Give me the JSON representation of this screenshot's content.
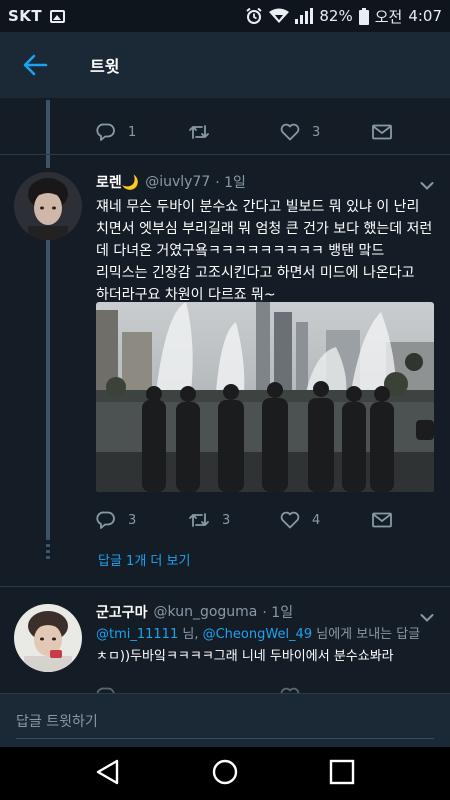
{
  "status_bar": {
    "carrier": "SKT",
    "battery": "82%",
    "time_prefix": "오전",
    "time": "4:07"
  },
  "header": {
    "title": "트윗"
  },
  "prev_tweet": {
    "partial_text": "· ···   ··· ·· ···",
    "replies": "1",
    "retweets": "",
    "likes": "3"
  },
  "tweet": {
    "name": "로렌🌙",
    "handle": "@iuvly77",
    "time": "· 1일",
    "lines": [
      "쟤네 무슨 두바이 분수쇼 간다고 빌보드 뭐 있냐 이 난리",
      "치면서 엣부심 부리길래 뭐 엄청 큰 건가 보다 했는데 저런",
      "데 다녀온 거였구욬ㅋㅋㅋㅋㅋㅋㅋㅋㅋ 뱅탠 맠드",
      "리믹스는 긴장감 고조시킨다고 하면서 미드에 나온다고",
      "하더라구요 차원이 다르죠 뭐~"
    ],
    "replies": "3",
    "retweets": "3",
    "likes": "4",
    "more_replies": "답글 1개 더 보기"
  },
  "reply_tweet": {
    "name": "군고구마",
    "handle": "@kun_goguma",
    "time": "· 1일",
    "mention1": "@tmi_11111",
    "mention_sep": " 님, ",
    "mention2": "@CheongWel_49",
    "mention_suffix": " 님에게 보내는 답글",
    "text": "ㅊㅁ))두바잌ㅋㅋㅋㅋ그래 니네 두바이에서 분수쇼봐라"
  },
  "reply_bar": {
    "placeholder": "답글 트윗하기"
  },
  "colors": {
    "background": "#141d26",
    "header": "#1b2836",
    "accent": "#1da1f2",
    "muted": "#8899a6"
  },
  "icons": [
    "back-arrow-icon",
    "reply-icon",
    "retweet-icon",
    "like-icon",
    "share-icon",
    "chevron-down-icon",
    "nav-back-icon",
    "nav-home-icon",
    "nav-recents-icon"
  ]
}
